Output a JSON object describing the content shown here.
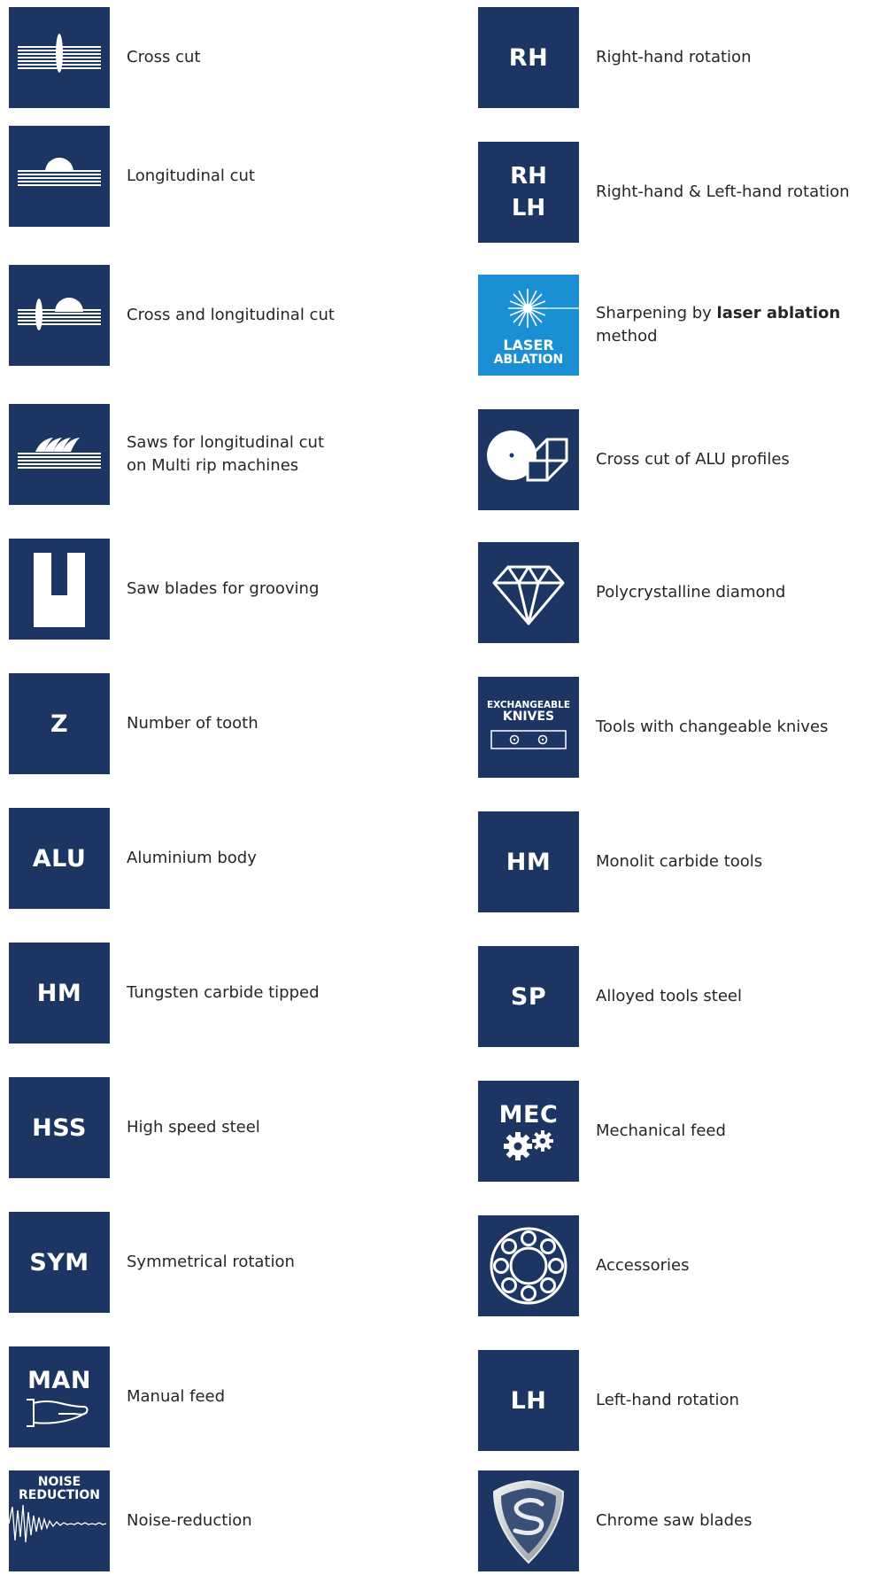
{
  "colors": {
    "tile": "#1d3562",
    "laser_tile": "#1b8fd3",
    "text": "#262626"
  },
  "left": [
    {
      "icon": "cross-cut-icon",
      "label": "Cross cut"
    },
    {
      "icon": "longitudinal-cut-icon",
      "label": "Longitudinal cut"
    },
    {
      "icon": "cross-longitudinal-cut-icon",
      "label": "Cross and longitudinal cut"
    },
    {
      "icon": "multi-rip-icon",
      "label_line1": "Saws for longitudinal cut",
      "label_line2": "on Multi rip machines"
    },
    {
      "icon": "grooving-icon",
      "label": "Saw blades for grooving"
    },
    {
      "code": "Z",
      "label": "Number of tooth"
    },
    {
      "code": "ALU",
      "label": "Aluminium body"
    },
    {
      "code": "HM",
      "label": "Tungsten carbide tipped"
    },
    {
      "code": "HSS",
      "label": "High speed steel"
    },
    {
      "code": "SYM",
      "label": "Symmetrical rotation"
    },
    {
      "code": "MAN",
      "icon": "hand-icon",
      "label": "Manual feed"
    },
    {
      "code_line1": "NOISE",
      "code_line2": "REDUCTION",
      "icon": "waveform-icon",
      "label": "Noise-reduction"
    }
  ],
  "right": [
    {
      "code": "RH",
      "label": "Right-hand rotation"
    },
    {
      "code_line1": "RH",
      "code_line2": "LH",
      "label": "Right-hand & Left-hand rotation"
    },
    {
      "code_line1": "LASER",
      "code_line2": "ABLATION",
      "icon": "laser-burst-icon",
      "label_pre": "Sharpening by ",
      "label_bold": "laser ablation",
      "label_line2": "method"
    },
    {
      "icon": "alu-profile-icon",
      "label": "Cross cut of ALU profiles"
    },
    {
      "icon": "diamond-icon",
      "label": "Polycrystalline diamond"
    },
    {
      "code_line1": "EXCHANGEABLE",
      "code_line2": "KNIVES",
      "icon": "knife-plate-icon",
      "label": "Tools with changeable knives"
    },
    {
      "code": "HM",
      "label": "Monolit carbide tools"
    },
    {
      "code": "SP",
      "label": "Alloyed tools steel"
    },
    {
      "code": "MEC",
      "icon": "gears-icon",
      "label": "Mechanical feed"
    },
    {
      "icon": "bearing-icon",
      "label": "Accessories"
    },
    {
      "code": "LH",
      "label": "Left-hand rotation"
    },
    {
      "icon": "chrome-shield-icon",
      "label": "Chrome saw blades"
    }
  ]
}
